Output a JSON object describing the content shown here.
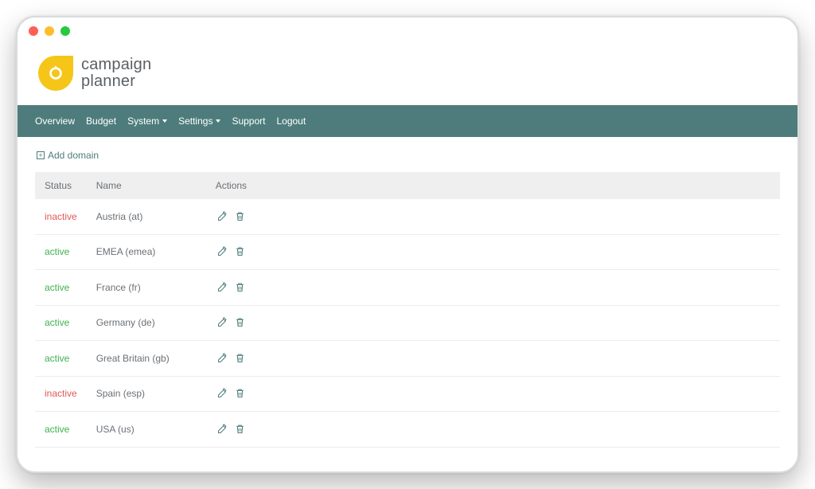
{
  "logo": {
    "line1": "campaign",
    "line2": "planner"
  },
  "nav": {
    "overview": "Overview",
    "budget": "Budget",
    "system": "System",
    "settings": "Settings",
    "support": "Support",
    "logout": "Logout"
  },
  "add_domain": "Add domain",
  "table": {
    "headers": {
      "status": "Status",
      "name": "Name",
      "actions": "Actions"
    },
    "rows": [
      {
        "status": "inactive",
        "status_label": "inactive",
        "name": "Austria (at)"
      },
      {
        "status": "active",
        "status_label": "active",
        "name": "EMEA (emea)"
      },
      {
        "status": "active",
        "status_label": "active",
        "name": "France (fr)"
      },
      {
        "status": "active",
        "status_label": "active",
        "name": "Germany (de)"
      },
      {
        "status": "active",
        "status_label": "active",
        "name": "Great Britain (gb)"
      },
      {
        "status": "inactive",
        "status_label": "inactive",
        "name": "Spain (esp)"
      },
      {
        "status": "active",
        "status_label": "active",
        "name": "USA (us)"
      }
    ]
  }
}
